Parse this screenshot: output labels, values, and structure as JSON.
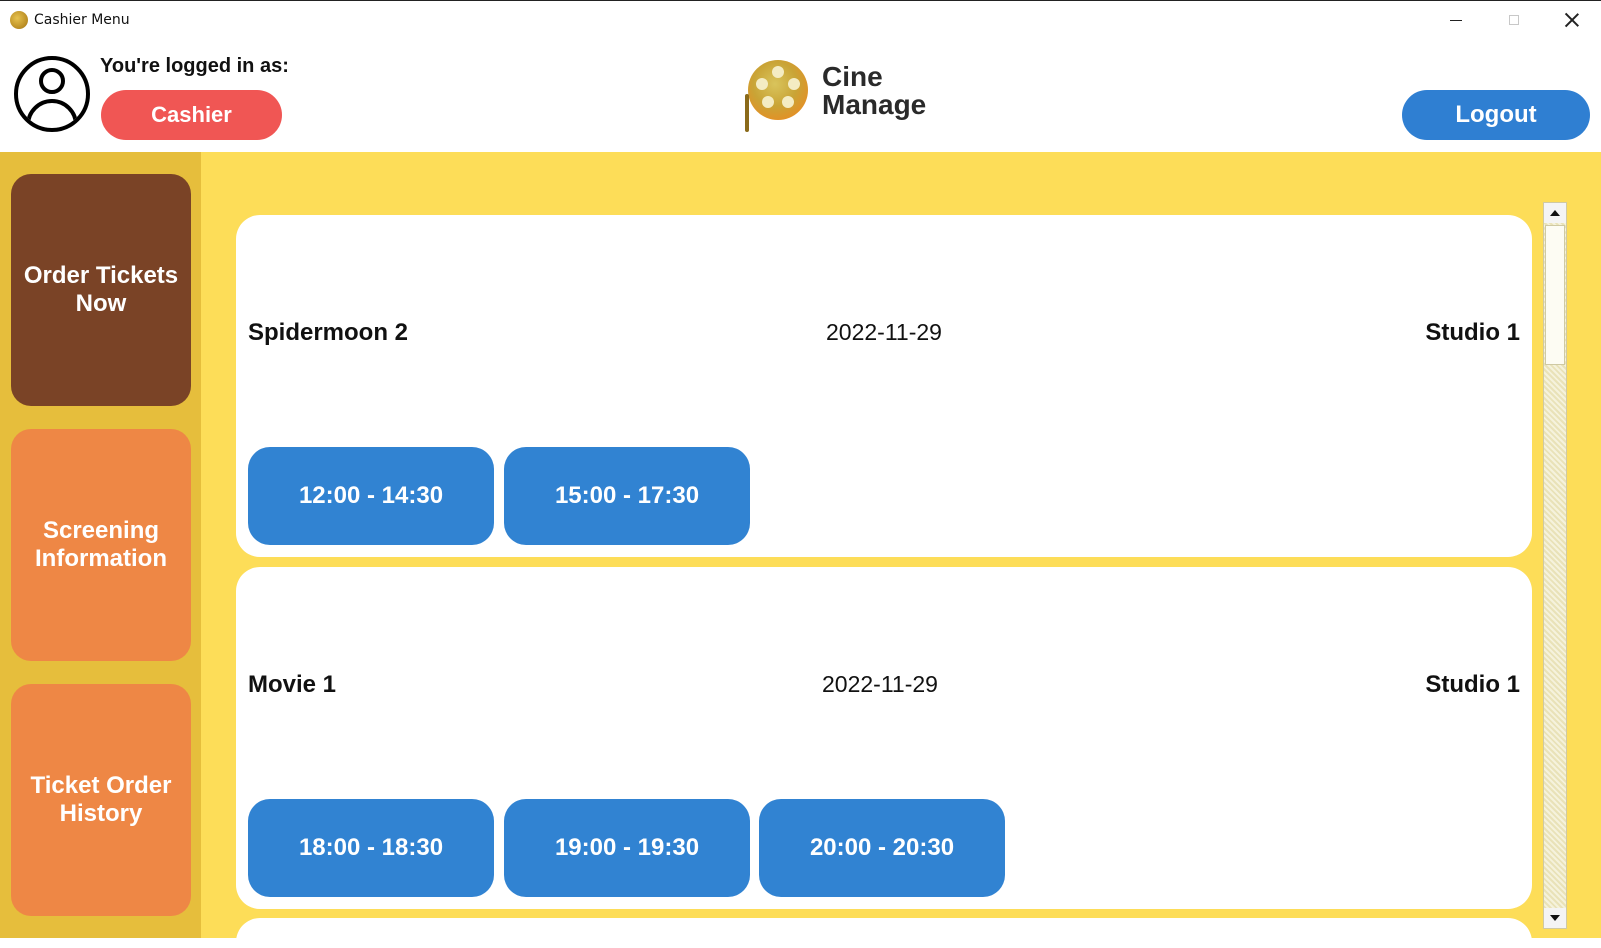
{
  "window": {
    "title": "Cashier Menu"
  },
  "header": {
    "logged_in_label": "You're logged in as:",
    "role": "Cashier",
    "logo_line1": "Cine",
    "logo_line2": "Manage",
    "logout_label": "Logout"
  },
  "sidebar": {
    "items": [
      {
        "label": "Order Tickets\nNow",
        "active": true
      },
      {
        "label": "Screening\nInformation",
        "active": false
      },
      {
        "label": "Ticket Order\nHistory",
        "active": false
      }
    ]
  },
  "screenings": [
    {
      "movie": "Spidermoon 2",
      "date": "2022-11-29",
      "studio": "Studio 1",
      "times": [
        "12:00 - 14:30",
        "15:00 - 17:30"
      ]
    },
    {
      "movie": "Movie 1",
      "date": "2022-11-29",
      "studio": "Studio 1",
      "times": [
        "18:00 - 18:30",
        "19:00 - 19:30",
        "20:00 - 20:30"
      ]
    }
  ],
  "colors": {
    "accent_blue": "#3183d2",
    "role_red": "#f05654",
    "active_nav": "#7a4326",
    "nav": "#ee8745",
    "sidebar_bg": "#e6be3c",
    "main_bg": "#fddd58"
  },
  "icons": {
    "app": "cinemanage-logo-icon",
    "user": "user-avatar-icon",
    "minimize": "minimize-icon",
    "maximize": "maximize-icon",
    "close": "close-icon"
  }
}
